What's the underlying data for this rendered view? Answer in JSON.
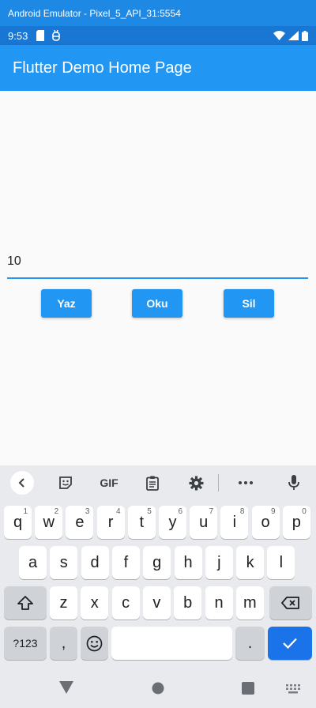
{
  "window": {
    "title": "Android Emulator - Pixel_5_API_31:5554"
  },
  "status_bar": {
    "time": "9:53"
  },
  "app_bar": {
    "title": "Flutter Demo Home Page"
  },
  "form": {
    "input_value": "10",
    "buttons": {
      "write": "Yaz",
      "read": "Oku",
      "delete": "Sil"
    }
  },
  "keyboard": {
    "toolbar": {
      "gif": "GIF"
    },
    "row1": [
      {
        "key": "q",
        "hint": "1"
      },
      {
        "key": "w",
        "hint": "2"
      },
      {
        "key": "e",
        "hint": "3"
      },
      {
        "key": "r",
        "hint": "4"
      },
      {
        "key": "t",
        "hint": "5"
      },
      {
        "key": "y",
        "hint": "6"
      },
      {
        "key": "u",
        "hint": "7"
      },
      {
        "key": "i",
        "hint": "8"
      },
      {
        "key": "o",
        "hint": "9"
      },
      {
        "key": "p",
        "hint": "0"
      }
    ],
    "row2": [
      "a",
      "s",
      "d",
      "f",
      "g",
      "h",
      "j",
      "k",
      "l"
    ],
    "row3": [
      "z",
      "x",
      "c",
      "v",
      "b",
      "n",
      "m"
    ],
    "symbols_key": "?123",
    "comma_key": ",",
    "period_key": ".",
    "colors": {
      "accent": "#1a73e8",
      "key": "#ffffff",
      "func_key": "#cfd3d8",
      "background": "#e8eaed"
    }
  },
  "colors": {
    "app_bar": "#2196f3",
    "status_bar": "#1976d2",
    "button": "#2196f3"
  }
}
